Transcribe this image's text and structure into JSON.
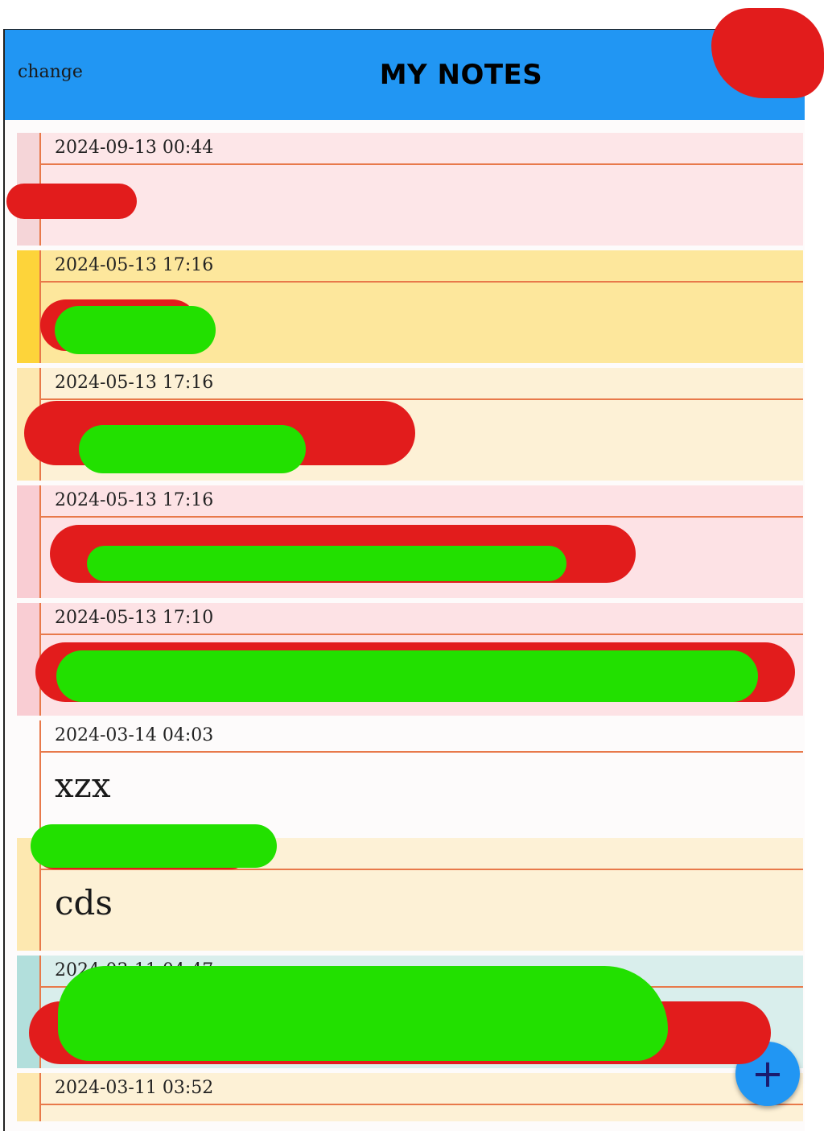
{
  "header": {
    "change_label": "change",
    "title": "MY NOTES"
  },
  "notes": [
    {
      "date": "2024-09-13 00:44",
      "body": "",
      "stripe": "#f5d5d8",
      "bg": "#fde6e8"
    },
    {
      "date": "2024-05-13 17:16",
      "body": "",
      "stripe": "#fdd43a",
      "bg": "#fde79c"
    },
    {
      "date": "2024-05-13 17:16",
      "body": "",
      "stripe": "#fde8b0",
      "bg": "#fdf1d6"
    },
    {
      "date": "2024-05-13 17:16",
      "body": "",
      "stripe": "#f9cdd3",
      "bg": "#fde2e5"
    },
    {
      "date": "2024-05-13 17:10",
      "body": "",
      "stripe": "#f9cdd3",
      "bg": "#fde2e5"
    },
    {
      "date": "2024-03-14 04:03",
      "body": "xzx",
      "stripe": "#fdfbfb",
      "bg": "#fdfbfb"
    },
    {
      "date": "",
      "body": "cds",
      "stripe": "#fde8b0",
      "bg": "#fdf1d6"
    },
    {
      "date": "2024-03-11 04:47",
      "body": "",
      "stripe": "#b2dfdc",
      "bg": "#d9eeec"
    },
    {
      "date": "2024-03-11 03:52",
      "body": "",
      "stripe": "#fde8b0",
      "bg": "#fdf1d6"
    }
  ],
  "fab": {
    "label": "+"
  },
  "colors": {
    "header": "#2196f3",
    "rule_line": "#e8794a",
    "fab": "#2196f3"
  }
}
